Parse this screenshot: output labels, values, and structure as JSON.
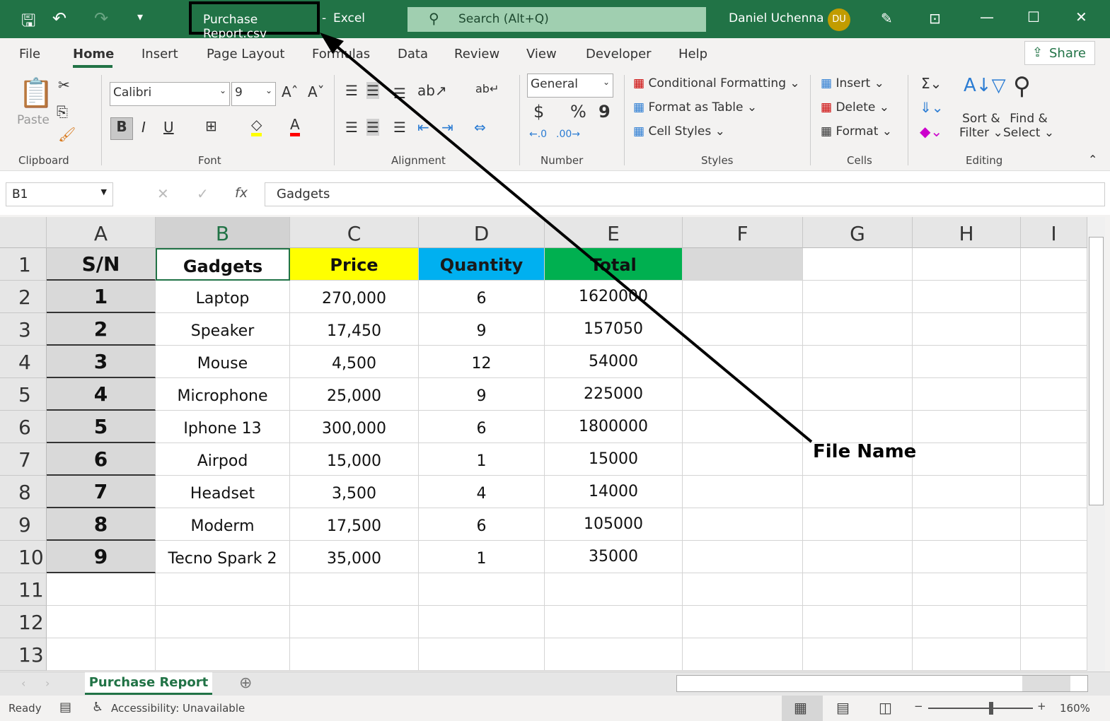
{
  "titlebar": {
    "file_name": "Purchase Report.csv",
    "separator": "-",
    "app": "Excel",
    "search_placeholder": "Search (Alt+Q)",
    "user_name": "Daniel Uchenna",
    "user_initials": "DU"
  },
  "tabs": [
    "File",
    "Home",
    "Insert",
    "Page Layout",
    "Formulas",
    "Data",
    "Review",
    "View",
    "Developer",
    "Help"
  ],
  "share_label": "Share",
  "ribbon": {
    "clipboard": {
      "label": "Clipboard",
      "paste": "Paste"
    },
    "font": {
      "label": "Font",
      "font_name": "Calibri",
      "font_size": "9",
      "bold": "B",
      "italic": "I",
      "underline": "U"
    },
    "alignment": {
      "label": "Alignment"
    },
    "number": {
      "label": "Number",
      "format": "General",
      "currency": "$",
      "percent": "%",
      "comma": "9"
    },
    "styles": {
      "label": "Styles",
      "conditional": "Conditional Formatting",
      "format_table": "Format as Table",
      "cell_styles": "Cell Styles"
    },
    "cells": {
      "label": "Cells",
      "insert": "Insert",
      "delete": "Delete",
      "format": "Format"
    },
    "editing": {
      "label": "Editing",
      "sort": "Sort &",
      "filter": "Filter",
      "find": "Find &",
      "select": "Select"
    }
  },
  "formula_bar": {
    "name_box": "B1",
    "fx": "fx",
    "value": "Gadgets"
  },
  "columns": [
    "A",
    "B",
    "C",
    "D",
    "E",
    "F",
    "G",
    "H",
    "I"
  ],
  "rows": [
    "1",
    "2",
    "3",
    "4",
    "5",
    "6",
    "7",
    "8",
    "9",
    "10",
    "11",
    "12",
    "13"
  ],
  "header": [
    "S/N",
    "Gadgets",
    "Price",
    "Quantity",
    "Total"
  ],
  "header_colors": {
    "price": "#ffff00",
    "quantity": "#00b0f0",
    "total": "#00b050"
  },
  "data": [
    [
      "1",
      "Laptop",
      "270,000",
      "6",
      "1620000"
    ],
    [
      "2",
      "Speaker",
      "17,450",
      "9",
      "157050"
    ],
    [
      "3",
      "Mouse",
      "4,500",
      "12",
      "54000"
    ],
    [
      "4",
      "Microphone",
      "25,000",
      "9",
      "225000"
    ],
    [
      "5",
      "Iphone 13",
      "300,000",
      "6",
      "1800000"
    ],
    [
      "6",
      "Airpod",
      "15,000",
      "1",
      "15000"
    ],
    [
      "7",
      "Headset",
      "3,500",
      "4",
      "14000"
    ],
    [
      "8",
      "Moderm",
      "17,500",
      "6",
      "105000"
    ],
    [
      "9",
      "Tecno Spark 2",
      "35,000",
      "1",
      "35000"
    ]
  ],
  "annotation": "File Name",
  "sheet_tab": "Purchase Report",
  "status": {
    "ready": "Ready",
    "accessibility": "Accessibility: Unavailable",
    "zoom": "160%",
    "zoom_percent": 160
  }
}
